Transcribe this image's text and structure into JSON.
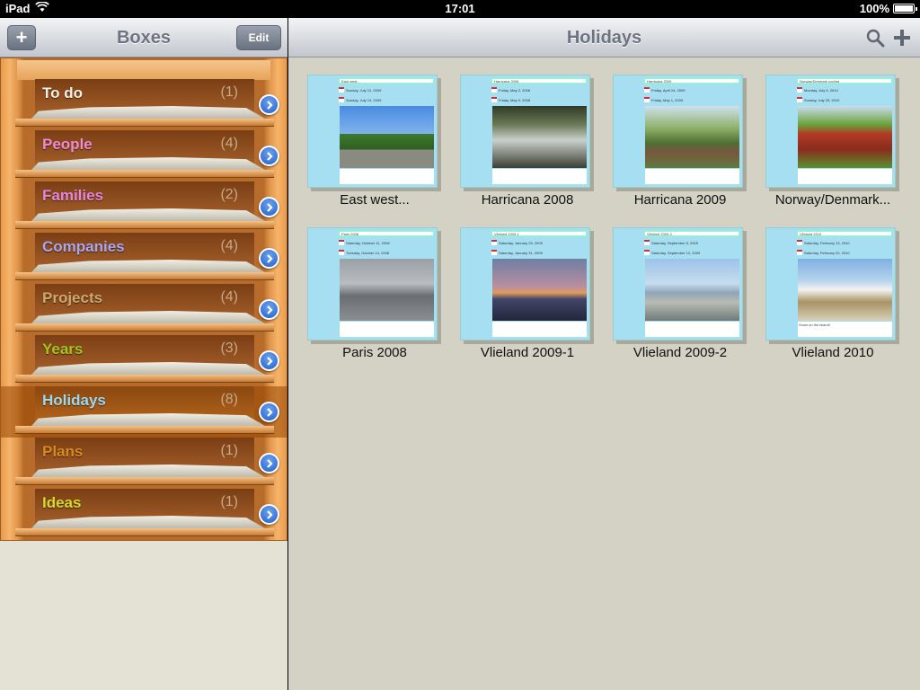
{
  "statusbar": {
    "device": "iPad",
    "time": "17:01",
    "battery": "100%",
    "battery_level": 1.0
  },
  "boxes": {
    "title": "Boxes",
    "add_icon": "plus-icon",
    "edit_label": "Edit",
    "items": [
      {
        "label": "To do",
        "count": "(1)",
        "color": "#f2efe5",
        "selected": false
      },
      {
        "label": "People",
        "count": "(4)",
        "color": "#f08bd1",
        "selected": false
      },
      {
        "label": "Families",
        "count": "(2)",
        "color": "#e487dc",
        "selected": false
      },
      {
        "label": "Companies",
        "count": "(4)",
        "color": "#a9a6f3",
        "selected": false
      },
      {
        "label": "Projects",
        "count": "(4)",
        "color": "#cfa96e",
        "selected": false
      },
      {
        "label": "Years",
        "count": "(3)",
        "color": "#a3c51f",
        "selected": false
      },
      {
        "label": "Holidays",
        "count": "(8)",
        "color": "#9fd9ef",
        "selected": true
      },
      {
        "label": "Plans",
        "count": "(1)",
        "color": "#d88a1e",
        "selected": false
      },
      {
        "label": "Ideas",
        "count": "(1)",
        "color": "#d9d92a",
        "selected": false
      }
    ]
  },
  "holidays": {
    "title": "Holidays",
    "search_icon": "search-icon",
    "add_icon": "plus-icon",
    "cards": [
      {
        "label": "East west...",
        "field_title": "East west...",
        "start": "Sunday, July 12, 2009",
        "end": "Sunday, July 19, 2009",
        "notes": "",
        "photo": "sculpture"
      },
      {
        "label": "Harricana 2008",
        "field_title": "Harricana 2008",
        "start": "Friday, May 2, 2008",
        "end": "Friday, May 9, 2008",
        "notes": "",
        "photo": "river"
      },
      {
        "label": "Harricana 2009",
        "field_title": "Harricana 2009",
        "start": "Friday, April 24, 2009",
        "end": "Friday, May 1, 2009",
        "notes": "",
        "photo": "cabin-forest"
      },
      {
        "label": "Norway/Denmark...",
        "field_title": "Norway/Denmark cycling",
        "start": "Monday, July 5, 2010",
        "end": "Sunday, July 25, 2010",
        "notes": "",
        "photo": "red-cabin"
      },
      {
        "label": "Paris 2008",
        "field_title": "Paris 2008",
        "start": "Saturday, October 11, 2008",
        "end": "Tuesday, October 14, 2008",
        "notes": "",
        "photo": "cyclist"
      },
      {
        "label": "Vlieland 2009-1",
        "field_title": "Vlieland 2009-1",
        "start": "Saturday, January 25, 2009",
        "end": "Saturday, January 31, 2009",
        "notes": "",
        "photo": "sunset-beach"
      },
      {
        "label": "Vlieland 2009-2",
        "field_title": "Vlieland 2009-2",
        "start": "Saturday, September 5, 2009",
        "end": "Saturday, September 12, 2009",
        "notes": "",
        "photo": "beach-walker"
      },
      {
        "label": "Vlieland 2010",
        "field_title": "Vlieland 2010",
        "start": "Saturday, February 13, 2010",
        "end": "Saturday, February 20, 2010",
        "notes": "Snow on the island!",
        "photo": "snowy-dunes"
      }
    ]
  }
}
